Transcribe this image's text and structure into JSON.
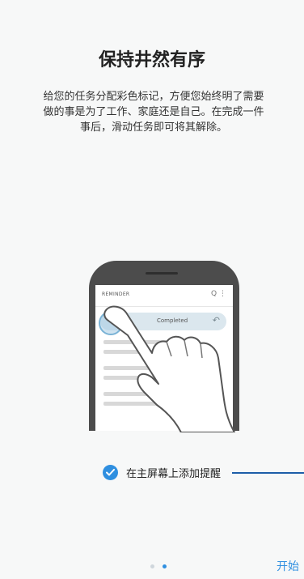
{
  "intro": {
    "title": "保持井然有序",
    "description": "给您的任务分配彩色标记，方便您始终明了需要做的事是为了工作、家庭还是自己。在完成一件事后，滑动任务即可将其解除。"
  },
  "illustration": {
    "app_title": "REMINDER",
    "app_icons": "Q ⋮",
    "completed_label": "Completed",
    "undo_symbol": "↶"
  },
  "option": {
    "label": "在主屏幕上添加提醒",
    "checked": true,
    "check_color": "#2f8fe0"
  },
  "pager": {
    "current": 2,
    "total": 2
  },
  "footer": {
    "start_label": "开始"
  },
  "colors": {
    "accent": "#2f8fe0",
    "callout": "#1d5ea8"
  }
}
